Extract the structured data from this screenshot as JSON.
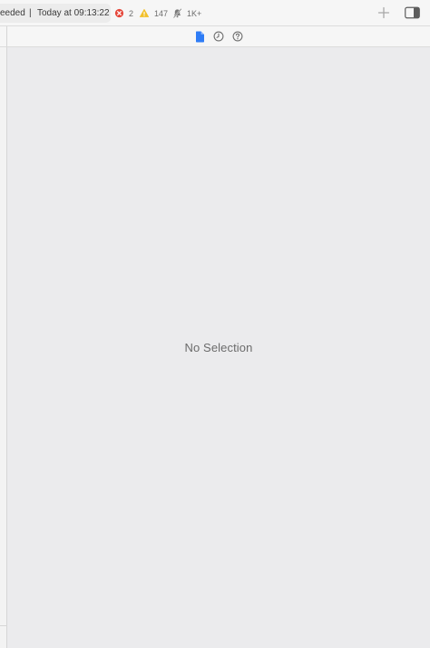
{
  "toolbar": {
    "status_left": "eeded",
    "separator": "|",
    "timestamp": "Today at 09:13:22",
    "error_count": "2",
    "warning_count": "147",
    "notification_count": "1K+",
    "icons": {
      "error": "error-circle-icon",
      "warning": "warning-triangle-icon",
      "notification": "bell-icon",
      "add": "plus-icon",
      "inspector_toggle": "sidebar-toggle-icon"
    },
    "colors": {
      "error": "#e5483c",
      "warning": "#f2c02b",
      "active_blue": "#2e7cf6"
    }
  },
  "inspector": {
    "tabs": [
      {
        "icon": "file-icon",
        "active": true
      },
      {
        "icon": "clock-history-icon",
        "active": false
      },
      {
        "icon": "help-circle-icon",
        "active": false
      }
    ]
  },
  "content": {
    "empty_message": "No Selection"
  }
}
